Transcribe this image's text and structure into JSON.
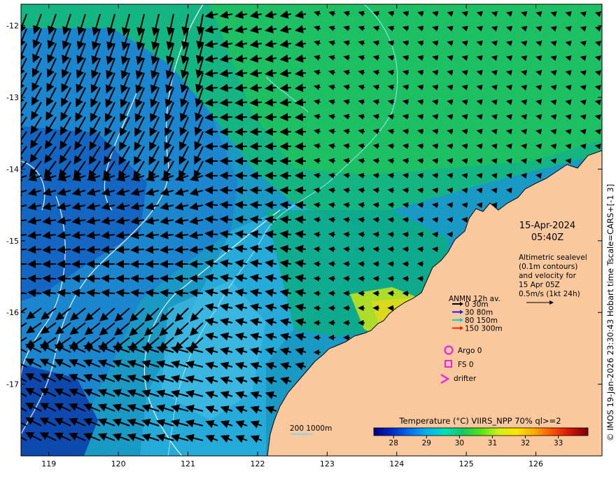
{
  "map": {
    "x_ticks": [
      "119",
      "120",
      "121",
      "122",
      "123",
      "124",
      "125",
      "126"
    ],
    "y_ticks": [
      "-12",
      "-13",
      "-14",
      "-15",
      "-16",
      "-17"
    ],
    "x_range": [
      118.6,
      126.95
    ],
    "y_range": [
      -18.0,
      -11.7
    ]
  },
  "annotation": {
    "date": "15-Apr-2024",
    "time": "05:40Z",
    "desc_lines": [
      "Altimetric sealevel",
      "(0.1m contours)",
      "and velocity for",
      "15 Apr 05Z",
      "0.5m/s (1kt 24h)"
    ]
  },
  "legend": {
    "title": "ANMN 12h av.",
    "items": [
      {
        "label": "0 30m",
        "color": "#000000"
      },
      {
        "label": "30 80m",
        "color": "#1a1aff"
      },
      {
        "label": "80 150m",
        "color": "#00d2d2"
      },
      {
        "label": "150 300m",
        "color": "#ff2200"
      }
    ],
    "argo": "Argo 0",
    "fs": "FS 0",
    "drifter": "drifter",
    "marker_color": "#ee22ee"
  },
  "depth_label": "200  1000m",
  "colorbar": {
    "title": "Temperature (°C) VIIRS_NPP 70% ql>=2",
    "ticks": [
      "28",
      "29",
      "30",
      "31",
      "32",
      "33"
    ],
    "tick_values": [
      28,
      29,
      30,
      31,
      32,
      33
    ],
    "range": [
      27.4,
      33.9
    ],
    "stops": [
      "#000080",
      "#0028c8",
      "#0070f0",
      "#00b4f0",
      "#00e0b4",
      "#14c864",
      "#50e614",
      "#d2f014",
      "#ffe600",
      "#ffaa00",
      "#ff5000",
      "#d21400",
      "#7a0000"
    ]
  },
  "colors": {
    "land": "#f9c99d",
    "ocean_base": "#2fa9d8",
    "warm_patch": "#f0e614"
  },
  "credit": "© IMOS 19-Jan-2026 23:30:43 Hobart time Tscale=CARS+[-1 3]"
}
